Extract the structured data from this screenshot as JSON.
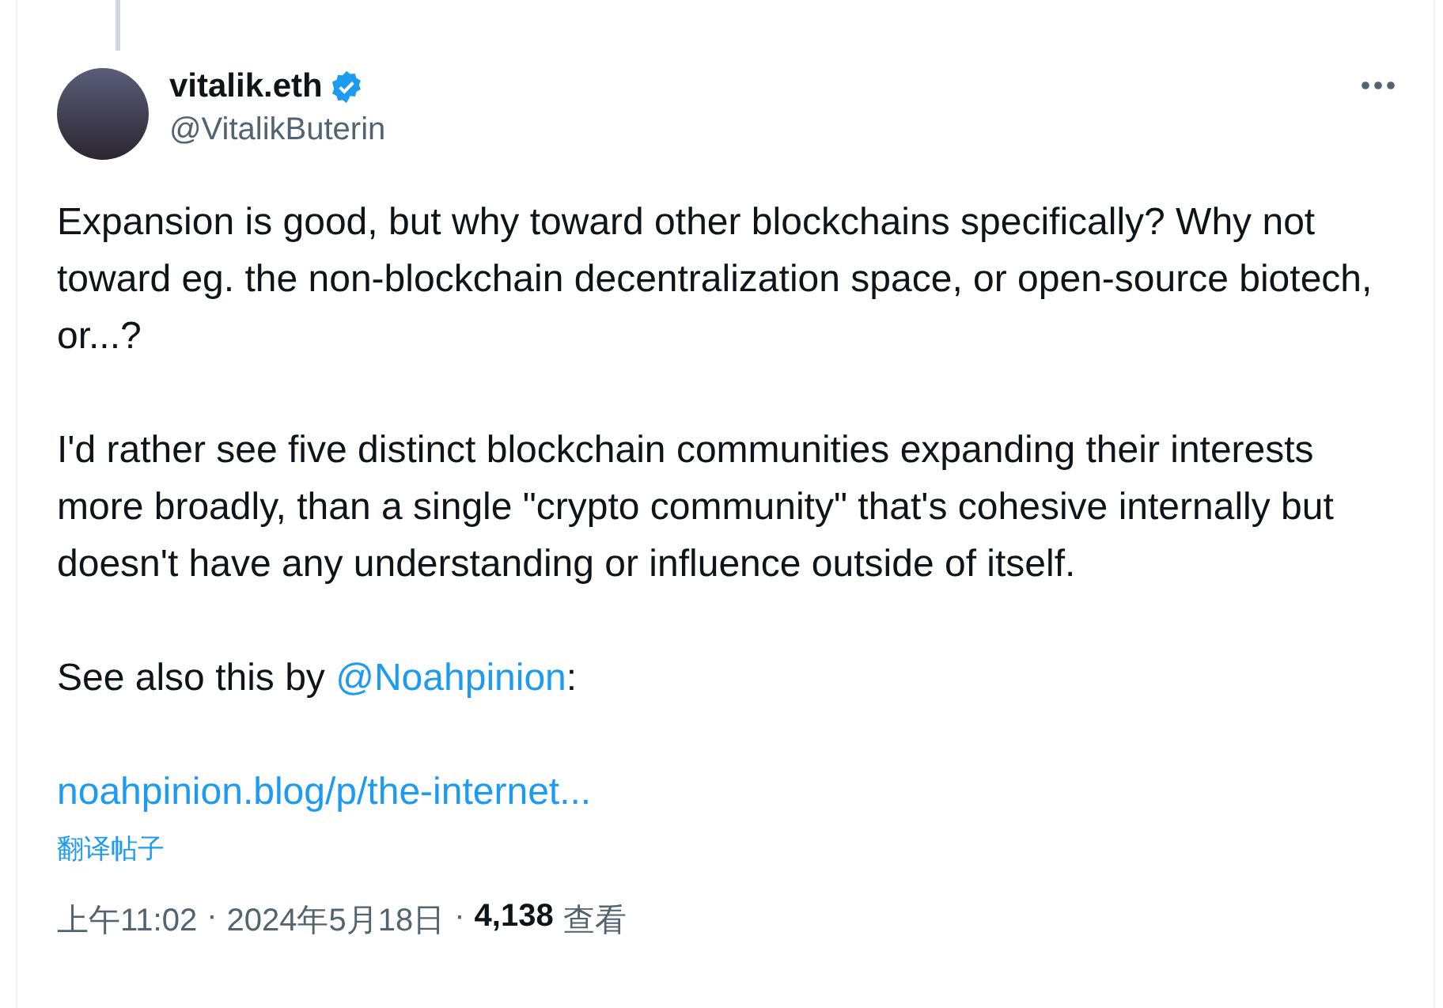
{
  "author": {
    "name": "vitalik.eth",
    "verified": true,
    "handle": "@VitalikButerin"
  },
  "paragraphs": [
    "Expansion is good, but why toward other blockchains specifically? Why not toward eg. the non-blockchain decentralization space, or open-source biotech, or...?",
    "I'd rather see five distinct blockchain communities expanding their interests more broadly, than a single \"crypto community\" that's cohesive internally but doesn't have any understanding or influence outside of itself."
  ],
  "mention_line": {
    "before": "See also this by ",
    "mention": "@Noahpinion",
    "after": ":"
  },
  "link": "noahpinion.blog/p/the-internet...",
  "translate": "翻译帖子",
  "meta": [
    {
      "kind": "time",
      "text": "上午11:02"
    },
    {
      "kind": "separator",
      "text": "·"
    },
    {
      "kind": "date",
      "text": "2024年5月18日"
    },
    {
      "kind": "separator",
      "text": "·"
    },
    {
      "kind": "views",
      "text": "4,138"
    },
    {
      "kind": "label",
      "text": "查看"
    }
  ]
}
